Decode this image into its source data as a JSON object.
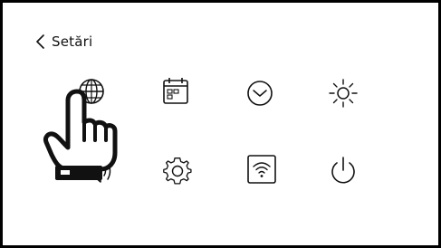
{
  "header": {
    "back_icon": "chevron-left-icon",
    "title": "Setări"
  },
  "icons": [
    {
      "name": "globe-icon"
    },
    {
      "name": "calendar-icon"
    },
    {
      "name": "clock-icon"
    },
    {
      "name": "brightness-icon"
    },
    {
      "name": "speaker-icon"
    },
    {
      "name": "gear-icon"
    },
    {
      "name": "wifi-icon"
    },
    {
      "name": "power-icon"
    }
  ],
  "cursor": {
    "name": "pointing-hand-icon"
  }
}
